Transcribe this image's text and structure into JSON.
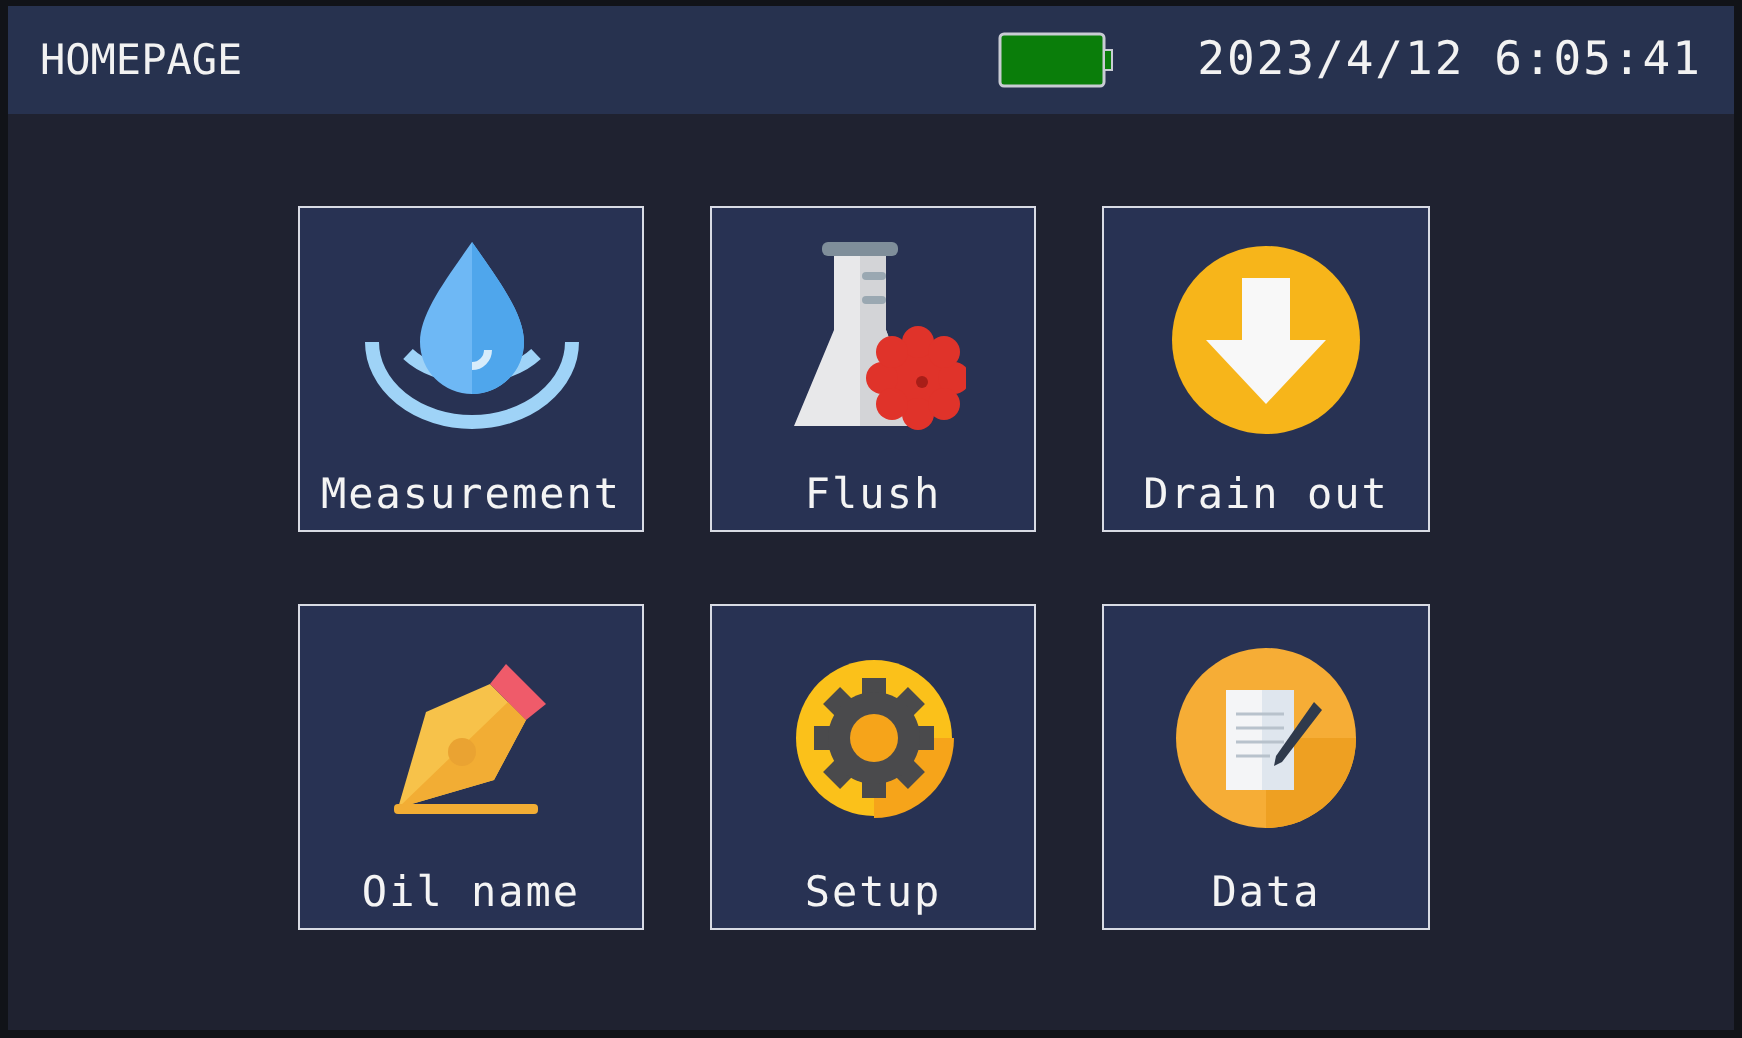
{
  "header": {
    "title": "HOMEPAGE",
    "datetime": "2023/4/12 6:05:41"
  },
  "tiles": [
    {
      "label": "Measurement",
      "kind": "drop"
    },
    {
      "label": "Flush",
      "kind": "flask"
    },
    {
      "label": "Drain out",
      "kind": "drain"
    },
    {
      "label": "Oil name",
      "kind": "pen"
    },
    {
      "label": "Setup",
      "kind": "gear"
    },
    {
      "label": "Data",
      "kind": "document"
    }
  ]
}
